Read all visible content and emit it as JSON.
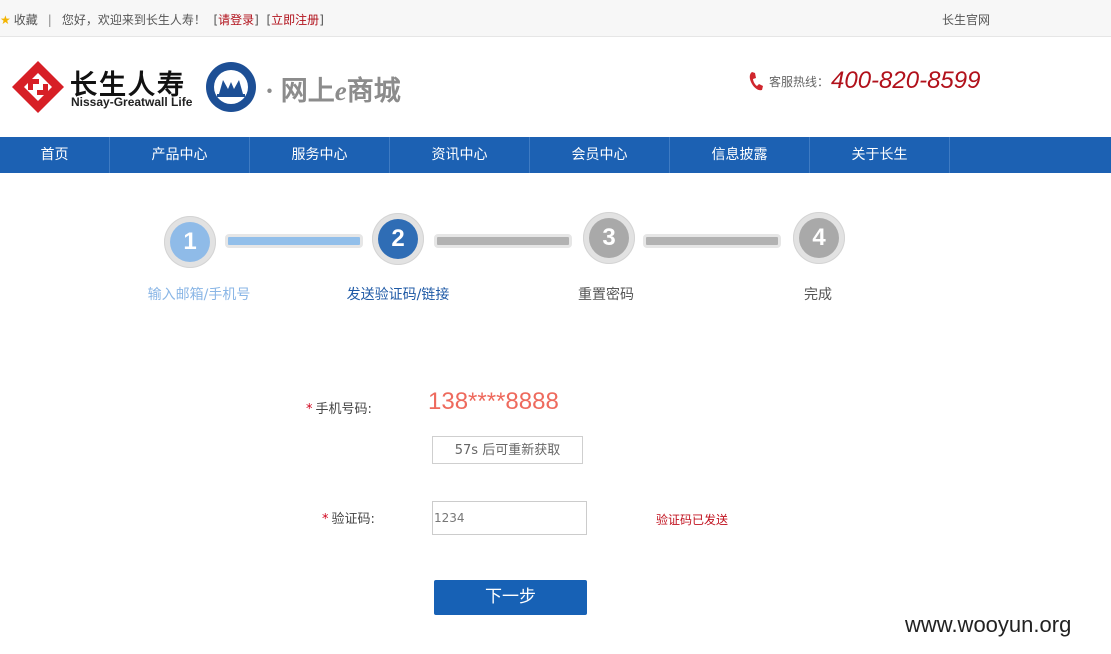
{
  "topbar": {
    "favorite": "收藏",
    "separator": "|",
    "welcome": "您好，欢迎来到长生人寿！",
    "login_link": "请登录",
    "register_link": "立即注册",
    "official_site": "长生官网"
  },
  "header": {
    "brand_cn": "长生人寿",
    "brand_en": "Nissay-Greatwall Life",
    "mall_prefix": "· 网上",
    "mall_e": "e",
    "mall_suffix": "商城",
    "hotline_label": "客服热线：",
    "hotline_number": "400-820-8599"
  },
  "nav": {
    "items": [
      "首页",
      "产品中心",
      "服务中心",
      "资讯中心",
      "会员中心",
      "信息披露",
      "关于长生"
    ]
  },
  "steps": {
    "items": [
      {
        "number": "1",
        "label": "输入邮箱/手机号",
        "state": "done"
      },
      {
        "number": "2",
        "label": "发送验证码/链接",
        "state": "active"
      },
      {
        "number": "3",
        "label": "重置密码",
        "state": "todo"
      },
      {
        "number": "4",
        "label": "完成",
        "state": "todo"
      }
    ]
  },
  "form": {
    "required_mark": "*",
    "phone_label": "手机号码:",
    "phone_value": "138****8888",
    "resend_label": "57s 后可重新获取",
    "code_label": "验证码:",
    "code_value": "1234",
    "code_status": "验证码已发送",
    "next_label": "下一步"
  },
  "watermark": "www.wooyun.org",
  "colors": {
    "nav_blue": "#1c61b3",
    "brand_red": "#b1111b",
    "step_done": "#8fbbe8",
    "step_active": "#2f6db5",
    "step_todo": "#a9a9a9"
  }
}
